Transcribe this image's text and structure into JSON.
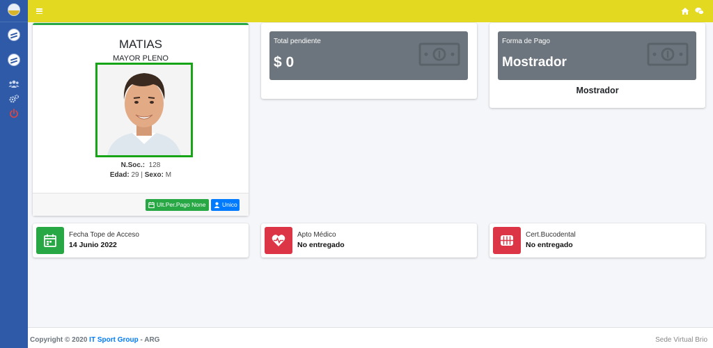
{
  "profile": {
    "name": "MATIAS",
    "category": "MAYOR PLENO",
    "nsoc_label": "N.Soc.:",
    "nsoc_value": "128",
    "edad_label": "Edad:",
    "edad_value": "29",
    "separator": "|",
    "sexo_label": "Sexo:",
    "sexo_value": "M",
    "ult_pago_label": "Ult.Per.Pago",
    "ult_pago_value": "None",
    "plan_label": "Unico"
  },
  "total_pendiente": {
    "label": "Total pendiente",
    "value": "$ 0"
  },
  "forma_pago": {
    "label": "Forma de Pago",
    "value": "Mostrador",
    "caption": "Mostrador"
  },
  "info_boxes": [
    {
      "title": "Fecha Tope de Acceso",
      "value": "14 Junio 2022",
      "icon": "calendar-icon",
      "color": "#28a745"
    },
    {
      "title": "Apto Médico",
      "value": "No entregado",
      "icon": "heartbeat-icon",
      "color": "#dc3545"
    },
    {
      "title": "Cert.Bucodental",
      "value": "No entregado",
      "icon": "teeth-icon",
      "color": "#dc3545"
    }
  ],
  "footer": {
    "copyright_prefix": "Copyright © 2020",
    "brand": "IT Sport Group",
    "suffix": "- ARG",
    "right_text": "Sede Virtual Brio"
  },
  "colors": {
    "sidebar": "#2e5aa8",
    "topbar": "#e3d921",
    "success": "#28a745",
    "danger": "#dc3545",
    "primary": "#007bff",
    "stat_box": "#6c757d"
  }
}
